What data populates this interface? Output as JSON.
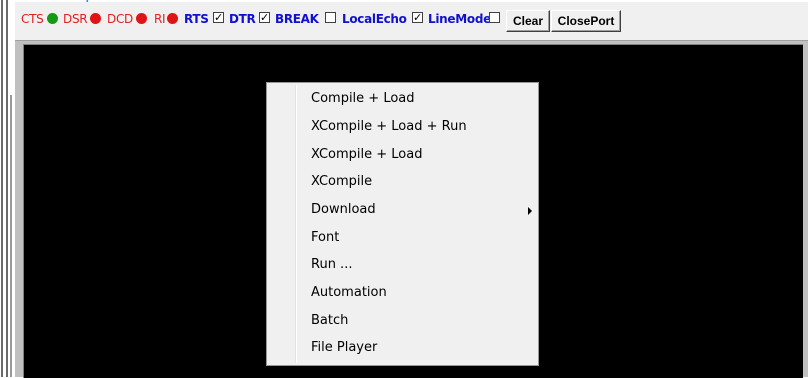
{
  "window_title_partial": "(",
  "toolbar": {
    "indicators": [
      {
        "label": "CTS",
        "state": "green"
      },
      {
        "label": "DSR",
        "state": "red"
      },
      {
        "label": "DCD",
        "state": "red"
      },
      {
        "label": "RI",
        "state": "red"
      }
    ],
    "checkboxes": [
      {
        "label": "RTS",
        "checked": true
      },
      {
        "label": "DTR",
        "checked": true
      },
      {
        "label": "BREAK",
        "checked": false
      },
      {
        "label": "LocalEcho",
        "checked": true
      },
      {
        "label": "LineMode",
        "checked": false
      }
    ],
    "check_glyph": "✓",
    "clear_label": "Clear",
    "closeport_label": "ClosePort"
  },
  "context_menu": {
    "items": [
      {
        "label": "Compile + Load"
      },
      {
        "label": "XCompile + Load + Run"
      },
      {
        "label": "XCompile + Load"
      },
      {
        "label": "XCompile"
      },
      {
        "label": "Download",
        "has_submenu": true
      },
      {
        "label": "Font"
      },
      {
        "label": "Run ..."
      },
      {
        "label": "Automation"
      },
      {
        "label": "Batch"
      },
      {
        "label": "File Player"
      }
    ]
  },
  "colors": {
    "terminal_bg": "#000000",
    "indicator_green": "#159a15",
    "indicator_red": "#e01414",
    "indicator_label": "#e02020",
    "checkbox_label": "#1010d0"
  }
}
